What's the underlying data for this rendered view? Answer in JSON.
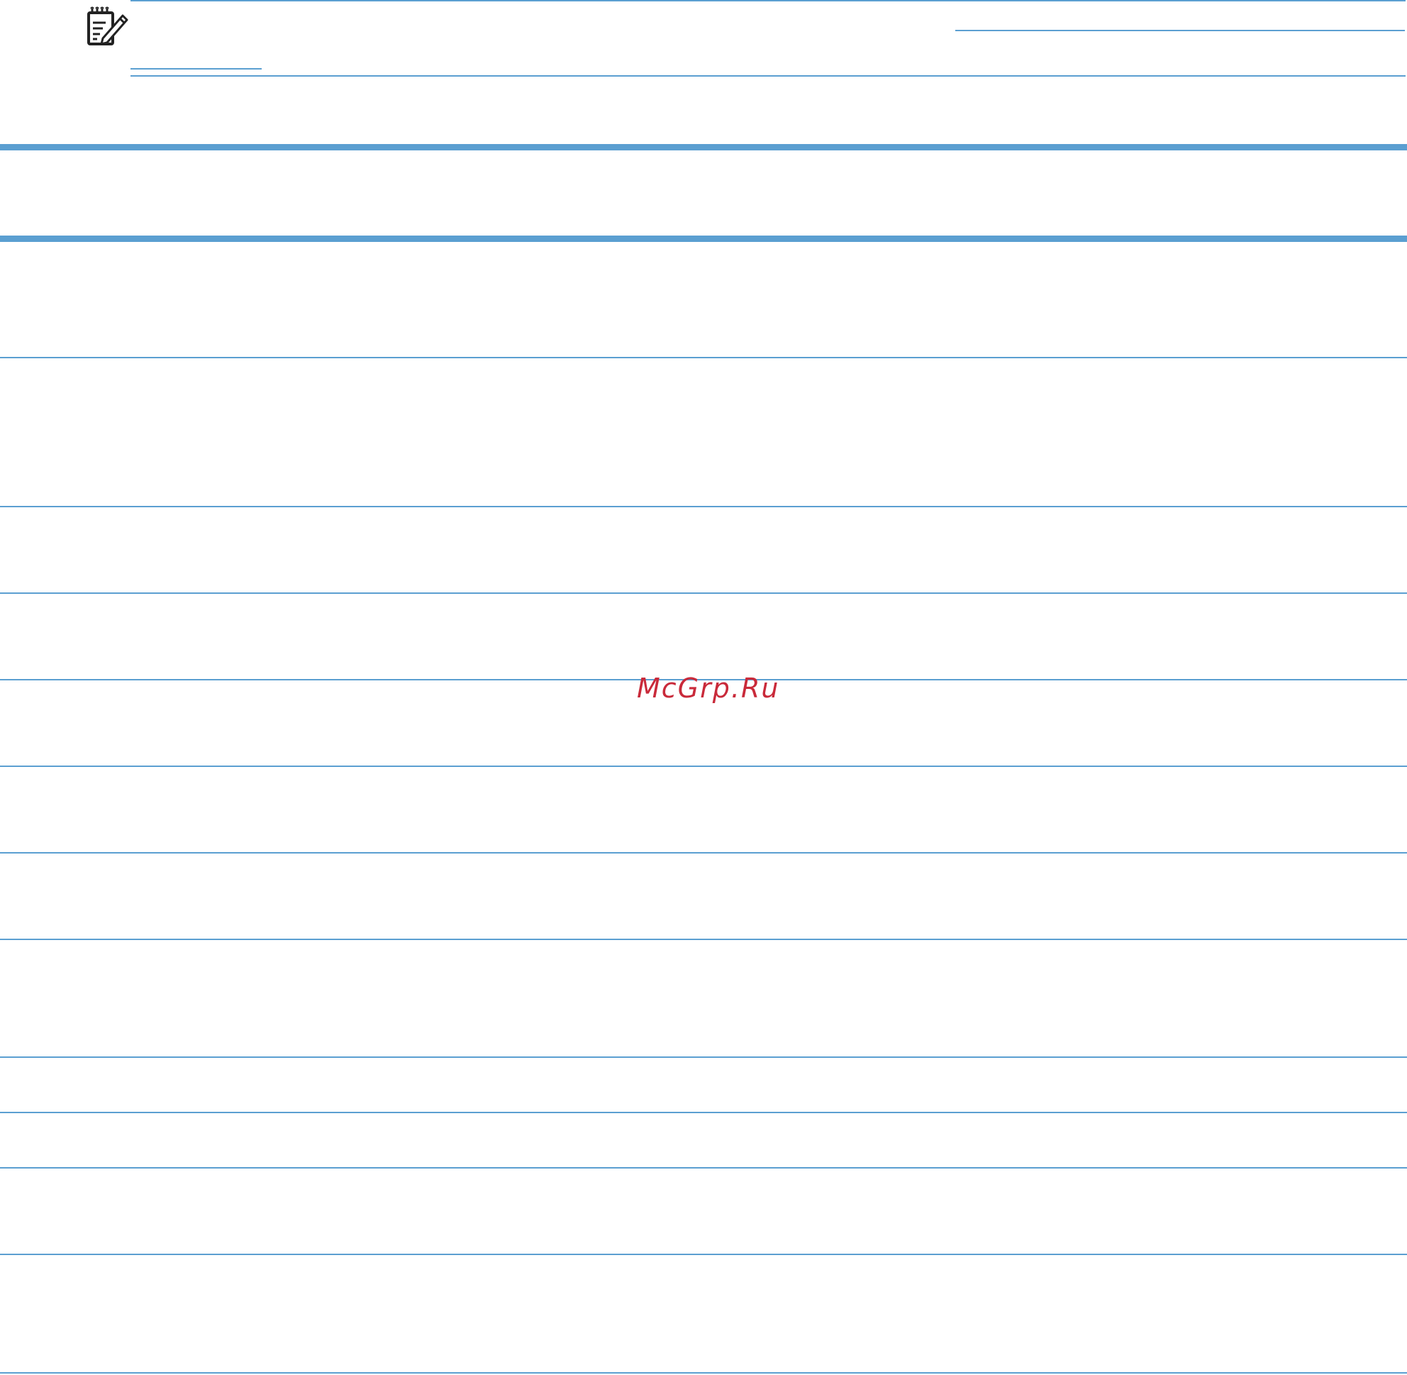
{
  "note": {
    "icon": "note-pencil-icon",
    "rule_color": "#5b9fd1"
  },
  "table": {
    "header_color": "#5b9fd1",
    "rows": 12
  },
  "watermark": {
    "text": "McGrp.Ru",
    "color": "#c92a3a"
  }
}
